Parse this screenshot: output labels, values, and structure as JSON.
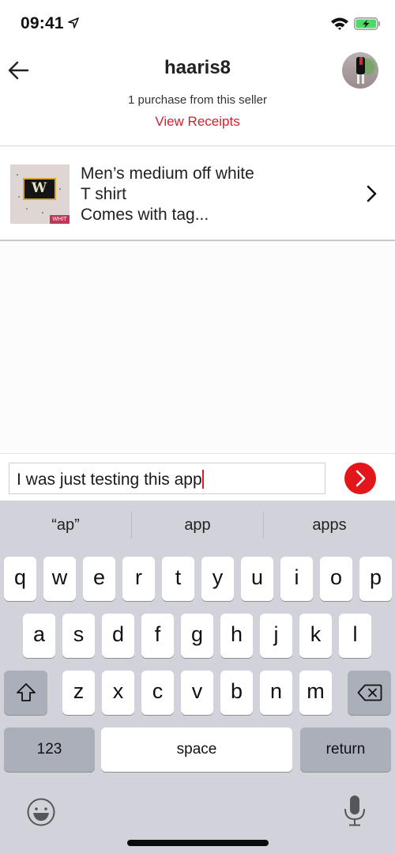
{
  "status_bar": {
    "time": "09:41",
    "location_icon": "location-arrow-icon",
    "wifi_icon": "wifi-icon",
    "battery_icon": "battery-charging-icon",
    "battery_color": "#4cd964"
  },
  "header": {
    "back_icon": "arrow-left-icon",
    "title": "haaris8",
    "subtitle": "1 purchase from this seller",
    "receipts_link": "View Receipts",
    "avatar_icon": "user-avatar"
  },
  "item": {
    "line1": "Men’s medium off white",
    "line2": "T shirt",
    "line3": "Comes with tag...",
    "thumb_tag": "WHIT",
    "chevron_icon": "chevron-right-icon"
  },
  "composer": {
    "message_value": "I was just testing this app",
    "send_icon": "send-arrow-icon",
    "accent_color": "#e3161c"
  },
  "keyboard": {
    "suggestions": [
      "“ap”",
      "app",
      "apps"
    ],
    "row1": [
      "q",
      "w",
      "e",
      "r",
      "t",
      "y",
      "u",
      "i",
      "o",
      "p"
    ],
    "row2": [
      "a",
      "s",
      "d",
      "f",
      "g",
      "h",
      "j",
      "k",
      "l"
    ],
    "row3": [
      "z",
      "x",
      "c",
      "v",
      "b",
      "n",
      "m"
    ],
    "numbers_label": "123",
    "space_label": "space",
    "return_label": "return",
    "shift_icon": "shift-icon",
    "delete_icon": "backspace-icon",
    "emoji_icon": "emoji-icon",
    "mic_icon": "microphone-icon"
  }
}
